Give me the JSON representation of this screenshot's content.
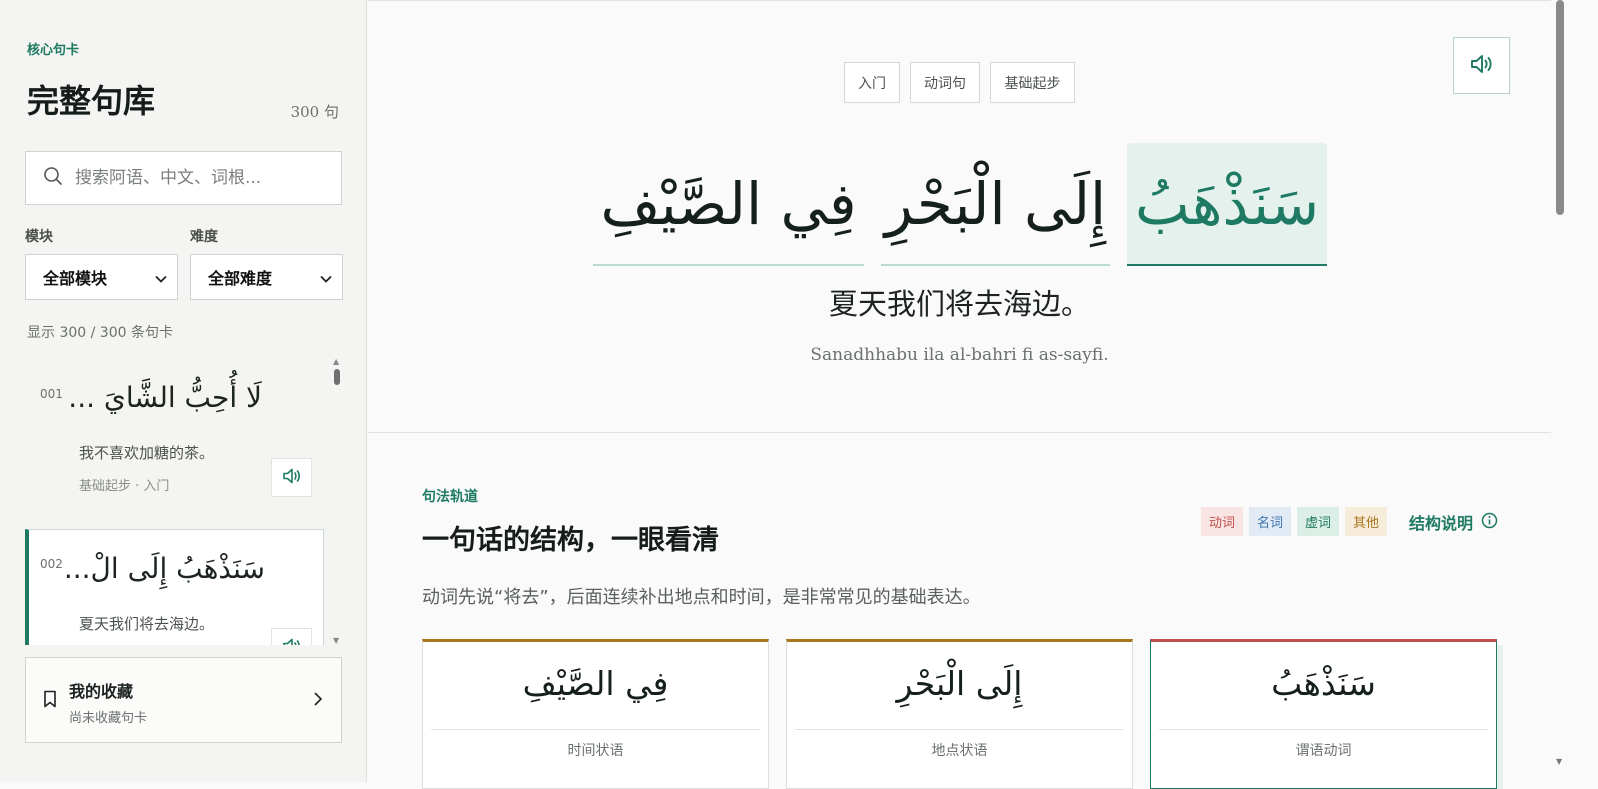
{
  "sidebar": {
    "eyebrow": "核心句卡",
    "title": "完整句库",
    "count": "300 句",
    "search_placeholder": "搜索阿语、中文、词根...",
    "filters": {
      "module_label": "模块",
      "module_value": "全部模块",
      "difficulty_label": "难度",
      "difficulty_value": "全部难度"
    },
    "showing": "显示 300 / 300 条句卡",
    "cards": [
      {
        "num": "001",
        "arabic": "لَا أُحِبُّ الشَّايَ ...",
        "chinese": "我不喜欢加糖的茶。",
        "meta": "基础起步 · 入门"
      },
      {
        "num": "002",
        "arabic": "سَنَذْهَبُ إِلَى الْ...",
        "chinese": "夏天我们将去海边。",
        "meta": ""
      }
    ],
    "favorites": {
      "title": "我的收藏",
      "subtitle": "尚未收藏句卡"
    }
  },
  "main": {
    "tags": [
      "入门",
      "动词句",
      "基础起步"
    ],
    "sentence_chunks": [
      {
        "text": "سَنَذْهَبُ",
        "highlight": true
      },
      {
        "text": "إِلَى الْبَحْرِ",
        "highlight": false
      },
      {
        "text": "فِي الصَّيْفِ",
        "highlight": false
      }
    ],
    "chinese": "夏天我们将去海边。",
    "transliteration": "Sanadhhabu ila al-bahri fi as-sayfi.",
    "section": {
      "eyebrow": "句法轨道",
      "title": "一句话的结构，一眼看清",
      "description": "动词先说“将去”，后面连续补出地点和时间，是非常常见的基础表达。",
      "legend": [
        {
          "label": "动词",
          "color": "#c0504d",
          "bg": "#f8e4e2"
        },
        {
          "label": "名词",
          "color": "#3b73b0",
          "bg": "#e2ebf5"
        },
        {
          "label": "虚词",
          "color": "#1e7a62",
          "bg": "#dcefe7"
        },
        {
          "label": "其他",
          "color": "#a8761c",
          "bg": "#f6ecd9"
        }
      ],
      "structure_link": "结构说明",
      "components": [
        {
          "arabic": "فِي الصَّيْفِ",
          "role": "时间状语"
        },
        {
          "arabic": "إِلَى الْبَحْرِ",
          "role": "地点状语"
        },
        {
          "arabic": "سَنَذْهَبُ",
          "role": "谓语动词"
        }
      ]
    }
  },
  "colors": {
    "accent": "#1e7a62",
    "verb": "#c0504d",
    "particle_border": "#a8761c"
  }
}
